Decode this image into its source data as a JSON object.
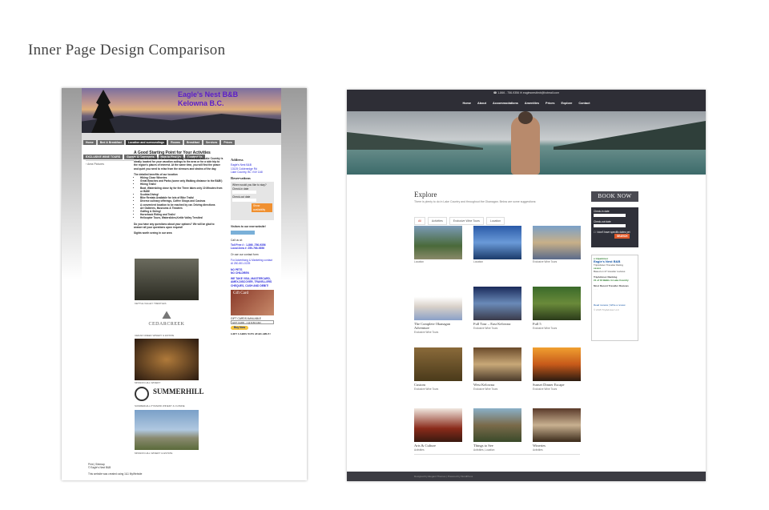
{
  "title": "Inner Page Design Comparison",
  "old_site": {
    "banner_title_1": "Eagle's Nest B&B",
    "banner_title_2": "Kelowna B.C.",
    "nav_row1": [
      "Home",
      "Bed & Breakfast",
      "Location and surroundings",
      "Rooms",
      "Breakfast",
      "Services",
      "Prices"
    ],
    "nav_row2": [
      "EXCLUSIVE WINE TOURS",
      "Guests & Comments",
      "How to Find Us",
      "Contact Us"
    ],
    "left_nav": "Area Pictures",
    "heading": "A Good Starting Point for Your Activities",
    "intro": "Whether it's relaxation or recreation, Eagle's Nest B&B in Lake Country is ideally located for your vacation outings to the area or for a side trip to the region's places of interest. At the same time, you will find the peace and quiet you need to relax from the stresses and strains of the day.",
    "benefits_head": "The detailed benefits of our location",
    "benefits": [
      "Hiking Close Wineries",
      "Great Beaches and Parks (some only Walking distance to the B&B!)",
      "Hiking Trails!",
      "Boat, Waterskiing close by for the Three lakes only 10 Minutes from ur B&B!",
      "Scubba Diving!",
      "Bike Rentals Available for lots of Bike Trails!",
      "Diverse culinary offerings, Coffee Shops and Casinos",
      "A convenient location to be reached by car. Driving directions",
      "Art Galleries, Museums & Theatres",
      "Golfing & Skiing!",
      "Horseback Riding and Trails!",
      "Helicopter Tours, Waterslides,Kettle Valley Trestles!"
    ],
    "questions": "Do you have any questions about your options? We will be glad to answer all your questions upon request!",
    "sights": "Sights worth seeing in our area",
    "captions": [
      "KETTLE VALLEY TRESTLES",
      "CEDAR CREEK WINERY & ESTATE",
      "MISSION HILL WINERY",
      "SUMMERHILL PYRAMID WINERY & CUISINE",
      "MISSION HILL WINERY & ESTATE"
    ],
    "cedarcreek": "CEDARCREEK",
    "summerhill": "SUMMERHILL",
    "sidebar": {
      "address_head": "Address",
      "address": [
        "Eagle's Nest B&B",
        "13125 Coldenedge Rd",
        "Lake Country, BC V4V 1A8"
      ],
      "reservations_head": "Reservations",
      "res_q": "When would you like to stay?",
      "checkin": "Check-in date",
      "checkout": "Check-out date",
      "button": "Show availability",
      "visitors": "Visitors to our new website!",
      "call": "Call us at:",
      "toll": "Toll Free # : 1-866 -756-9356",
      "local": "Local Area #: 250-766-9356",
      "contact": "Or use our contact form",
      "advertising": "For Advertising & Marketing contact Al 250-801-0225",
      "nopets": "NO PETS",
      "nochildren": "NO CHILDREN",
      "payments": "WE TAKE VISA, MASTERCARD, AMEX,DISCOVER, TRAVELLERS CHEQUES, CASH AND DEBIT!",
      "giftcard": "Gift Card",
      "gift_available": "GIFT CARDS AVAILABLE",
      "gift_select": "GIFT CARD - 1 @ $ 60 CAN",
      "buynow": "Buy Now",
      "gift_now": "GIFT CARDS NOW AVAILABLE!"
    },
    "footer": [
      "Print | Sitemap",
      "© Eagle's Nest B&B"
    ],
    "footer_credit": "This website was created using 1&1 MyWebsite"
  },
  "new_site": {
    "contact": "☎ 1-866 - 756-9356    ✉ eaglesnestbnb@hotmail.com",
    "menu": [
      "Home",
      "About",
      "Accommodations",
      "Amenities",
      "Prices",
      "Explore",
      "Contact"
    ],
    "explore_title": "Explore",
    "explore_sub": "There is plenty to do in Lake Country and throughout the Okanagan. Below are some suggestions:",
    "filters": [
      "All",
      "Activities",
      "Exclusive Wine Tours",
      "Location"
    ],
    "cards": [
      {
        "title": "",
        "cat": "Location"
      },
      {
        "title": "",
        "cat": "Location"
      },
      {
        "title": "",
        "cat": "Exclusive Wine Tours"
      },
      {
        "title": "The Complete Okanagan Adventure",
        "cat": "Exclusive Wine Tours"
      },
      {
        "title": "Full Tour – East Kelowna",
        "cat": "Exclusive Wine Tours"
      },
      {
        "title": "Full 5",
        "cat": "Exclusive Wine Tours"
      },
      {
        "title": "Custom",
        "cat": "Exclusive Wine Tours"
      },
      {
        "title": "West Kelowna",
        "cat": "Exclusive Wine Tours"
      },
      {
        "title": "Sunset Dinner Escape",
        "cat": "Exclusive Wine Tours"
      },
      {
        "title": "Arts & Culture",
        "cat": "Activities"
      },
      {
        "title": "Things to See",
        "cat": "Activities, Location"
      },
      {
        "title": "Wineries",
        "cat": "Activities"
      }
    ],
    "book": "BOOK NOW",
    "checkin": "Check-in date",
    "checkout": "Check-out date",
    "nodates": "I don't have specific dates yet",
    "search": "SEARCH",
    "ta": {
      "name": "Eagle's Nest B&B",
      "rating": "TripAdvisor Traveller Rating",
      "reviews": "Based on 27 traveller reviews",
      "ranking": "TripAdvisor Ranking",
      "rank": "#1 of 16 B&Bs in Lake Country",
      "recent": "Most Recent Traveller Reviews",
      "more": "Read reviews | Write a review",
      "copy": "© 2015 TripAdvisor LLC"
    },
    "footer": "Designed by Elegant Themes | Powered by WordPress"
  }
}
